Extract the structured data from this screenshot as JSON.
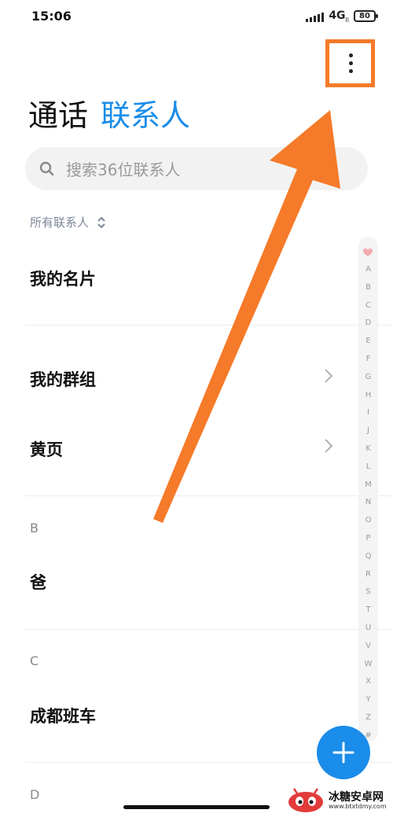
{
  "status_bar": {
    "time": "15:06",
    "network": "4G",
    "battery": "80"
  },
  "header": {
    "tab_calls": "通话",
    "tab_contacts": "联系人"
  },
  "search": {
    "placeholder": "搜索36位联系人"
  },
  "filter": {
    "label": "所有联系人"
  },
  "items": {
    "my_card": "我的名片",
    "my_groups": "我的群组",
    "yellow_pages": "黄页"
  },
  "sections": [
    {
      "letter": "B",
      "contact": "爸"
    },
    {
      "letter": "C",
      "contact": "成都班车"
    },
    {
      "letter": "D"
    }
  ],
  "alphabet_index": [
    "A",
    "B",
    "C",
    "D",
    "E",
    "F",
    "G",
    "H",
    "I",
    "J",
    "K",
    "L",
    "M",
    "N",
    "O",
    "P",
    "Q",
    "R",
    "S",
    "T",
    "U",
    "V",
    "W",
    "X",
    "Y",
    "Z",
    "#"
  ],
  "icons": {
    "more": "more-vert-icon",
    "search": "search-icon",
    "filter": "sort-toggle-icon",
    "chevron": "chevron-right-icon",
    "fab": "plus-icon",
    "index_top": "heart-icon"
  },
  "colors": {
    "accent": "#1a8ce9",
    "annotation": "#f57a29"
  },
  "watermark": {
    "title": "冰糖安卓网",
    "url": "www.btxtdmy.com"
  }
}
